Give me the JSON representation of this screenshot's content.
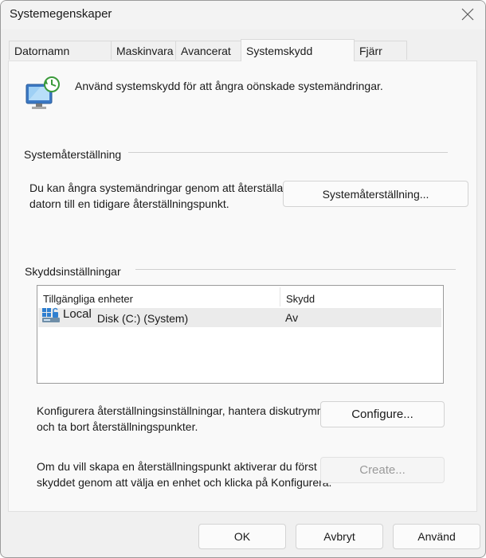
{
  "window": {
    "title": "Systemegenskaper"
  },
  "tabs": [
    {
      "label": "Datornamn"
    },
    {
      "label": "Maskinvara"
    },
    {
      "label": "Avancerat"
    },
    {
      "label": "Systemskydd"
    },
    {
      "label": "Fjärr"
    }
  ],
  "intro": {
    "text": "Använd systemskydd för att ångra oönskade systemändringar."
  },
  "restore_group": {
    "label": "Systemåterställning",
    "description_line1": "Du kan ångra systemändringar genom att återställa",
    "description_line2": "datorn till en tidigare återställningspunkt.",
    "button_label": "Systemåterställning..."
  },
  "protection_group": {
    "label": "Skyddsinställningar",
    "columns": [
      "Tillgängliga enheter",
      "Skydd"
    ],
    "rows": [
      {
        "drive_prefix": "Local",
        "drive_name": " Disk (C:) (System)",
        "protection": "Av"
      }
    ],
    "configure_line1": "Konfigurera återställningsinställningar, hantera diskutrymme",
    "configure_line2": "och ta bort återställningspunkter.",
    "configure_button": "Configure...",
    "create_line1": "Om du vill skapa en återställningspunkt aktiverar du först",
    "create_line2": "skyddet genom att välja en enhet och klicka på Konfigurera.",
    "create_button": "Create..."
  },
  "footer": {
    "ok": "OK",
    "cancel": "Avbryt",
    "apply": "Använd"
  }
}
